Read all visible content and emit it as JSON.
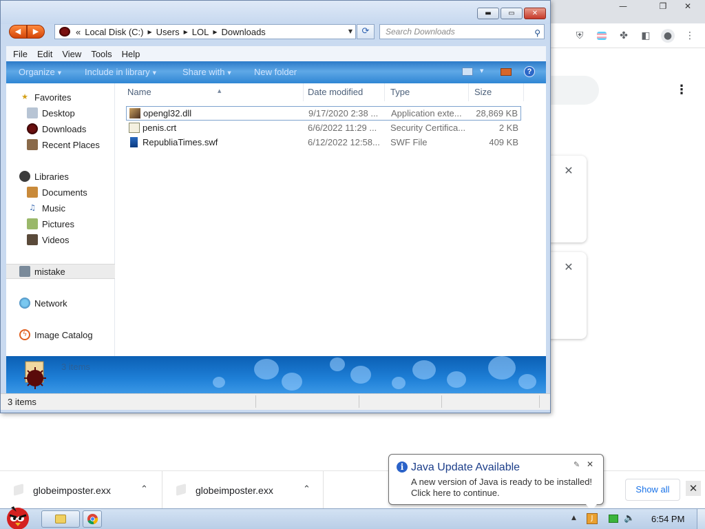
{
  "browser": {
    "window_controls": {
      "minimize": "—",
      "restore": "❐",
      "close": "✕"
    },
    "extension_icons": [
      "shield-icon",
      "flag-icon",
      "puzzle-icon",
      "side-panel-icon",
      "profile-icon",
      "menu-icon"
    ],
    "page_menu": "⋮",
    "cards": [
      {
        "close": "✕"
      },
      {
        "close": "✕"
      }
    ]
  },
  "explorer": {
    "window_controls": {
      "minimize": "▬",
      "maximize": "▭",
      "close": "✕"
    },
    "address": {
      "prefix": "«",
      "crumbs": [
        "Local Disk (C:)",
        "Users",
        "LOL",
        "Downloads"
      ],
      "separator": "▶"
    },
    "search_placeholder": "Search Downloads",
    "menu": [
      "File",
      "Edit",
      "View",
      "Tools",
      "Help"
    ],
    "commands": {
      "organize": "Organize",
      "include_in_library": "Include in library",
      "share_with": "Share with",
      "new_folder": "New folder",
      "help": "?"
    },
    "nav": {
      "favorites": "Favorites",
      "desktop": "Desktop",
      "downloads": "Downloads",
      "recent_places": "Recent Places",
      "libraries": "Libraries",
      "documents": "Documents",
      "music": "Music",
      "pictures": "Pictures",
      "videos": "Videos",
      "mistake": "mistake",
      "network": "Network",
      "image_catalog": "Image Catalog"
    },
    "columns": {
      "name": "Name",
      "date": "Date modified",
      "type": "Type",
      "size": "Size"
    },
    "files": [
      {
        "name": "opengl32.dll",
        "date": "9/17/2020 2:38 ...",
        "type": "Application exte...",
        "size": "28,869 KB"
      },
      {
        "name": "penis.crt",
        "date": "6/6/2022 11:29 ...",
        "type": "Security Certifica...",
        "size": "2 KB"
      },
      {
        "name": "RepubliaTimes.swf",
        "date": "6/12/2022 12:58...",
        "type": "SWF File",
        "size": "409 KB"
      }
    ],
    "details_count": "3 items",
    "status": "3 items"
  },
  "downloads": {
    "items": [
      {
        "name": "globeimposter.exx",
        "caret": "⌃"
      },
      {
        "name": "globeimposter.exx",
        "caret": "⌃"
      }
    ],
    "show_all": "Show all",
    "close": "✕"
  },
  "java": {
    "title": "Java Update Available",
    "line1": "A new version of Java is ready to be installed!",
    "line2": "Click here to continue.",
    "close": "✕"
  },
  "taskbar": {
    "clock": "6:54 PM",
    "tray_expand": "▲"
  }
}
